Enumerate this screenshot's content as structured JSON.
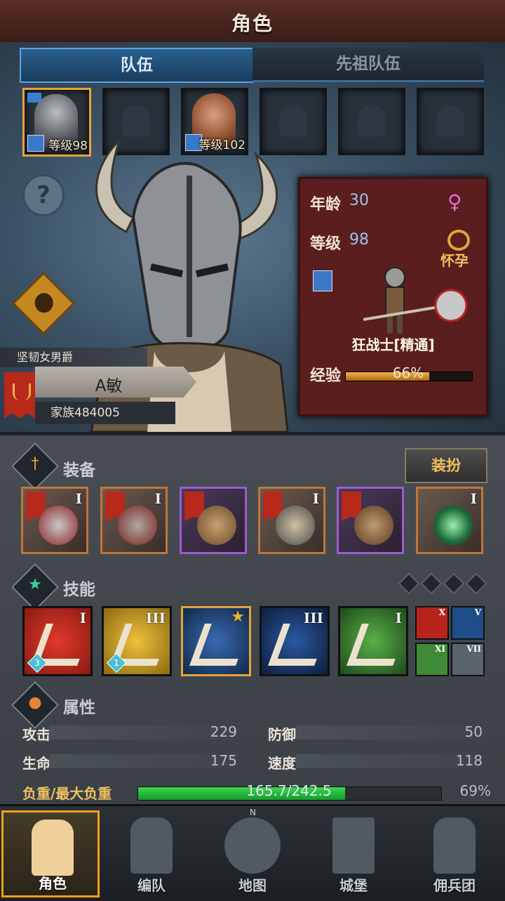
{
  "header": {
    "title": "角色"
  },
  "tabs": [
    {
      "label": "队伍",
      "active": true
    },
    {
      "label": "先祖队伍",
      "active": false
    }
  ],
  "party_slots": [
    {
      "filled": true,
      "selected": true,
      "level": "等级98"
    },
    {
      "filled": false
    },
    {
      "filled": true,
      "selected": false,
      "level": "等级102"
    },
    {
      "filled": false
    },
    {
      "filled": false
    },
    {
      "filled": false
    }
  ],
  "character": {
    "title_tag": "坚韧女男爵",
    "name": "A敏",
    "clan": "家族484005"
  },
  "info_card": {
    "age_label": "年龄",
    "age_value": "30",
    "gender_icon": "female-icon",
    "level_label": "等级",
    "level_value": "98",
    "status": "怀孕",
    "job": "狂战士[精通]",
    "xp_label": "经验",
    "xp_text": "66%",
    "xp_fraction": 0.66
  },
  "equipment": {
    "label": "装备",
    "dress_button": "装扮",
    "items": [
      {
        "tier": "I",
        "rarity": "orange"
      },
      {
        "tier": "I",
        "rarity": "orange"
      },
      {
        "tier": "",
        "rarity": "purple"
      },
      {
        "tier": "I",
        "rarity": "orange"
      },
      {
        "tier": "",
        "rarity": "purple"
      },
      {
        "tier": "I",
        "rarity": "orange"
      }
    ]
  },
  "skills": {
    "label": "技能",
    "items": [
      {
        "tier": "I",
        "badge": "3",
        "color": "#b8231c"
      },
      {
        "tier": "III",
        "badge": "1",
        "color": "#c49a1c"
      },
      {
        "tier": "",
        "badge": "",
        "color": "#1e4d8a",
        "star": true
      },
      {
        "tier": "III",
        "badge": "",
        "color": "#1e3f7a"
      },
      {
        "tier": "I",
        "badge": "",
        "color": "#3f8a36"
      }
    ],
    "mini": [
      {
        "tier": "X",
        "color": "#b8231c"
      },
      {
        "tier": "V",
        "color": "#1e4d8a"
      },
      {
        "tier": "XI",
        "color": "#3f8a36"
      },
      {
        "tier": "VII",
        "color": "#5a646c"
      }
    ]
  },
  "attributes": {
    "label": "属性",
    "attack_label": "攻击",
    "attack": "229",
    "defense_label": "防御",
    "defense": "50",
    "hp_label": "生命",
    "hp": "175",
    "speed_label": "速度",
    "speed": "118",
    "load_label": "负重/最大负重",
    "load_text": "165.7/242.5",
    "load_percent": "69%",
    "load_fraction": 0.683
  },
  "nav": [
    {
      "label": "角色",
      "active": true
    },
    {
      "label": "编队",
      "active": false
    },
    {
      "label": "地图",
      "active": false,
      "compass": "N"
    },
    {
      "label": "城堡",
      "active": false
    },
    {
      "label": "佣兵团",
      "active": false
    }
  ],
  "colors": {
    "accent": "#e7a33a",
    "tab_active": "#2b5f8e",
    "card": "#5a1e1e",
    "load": "#2bbf45"
  }
}
